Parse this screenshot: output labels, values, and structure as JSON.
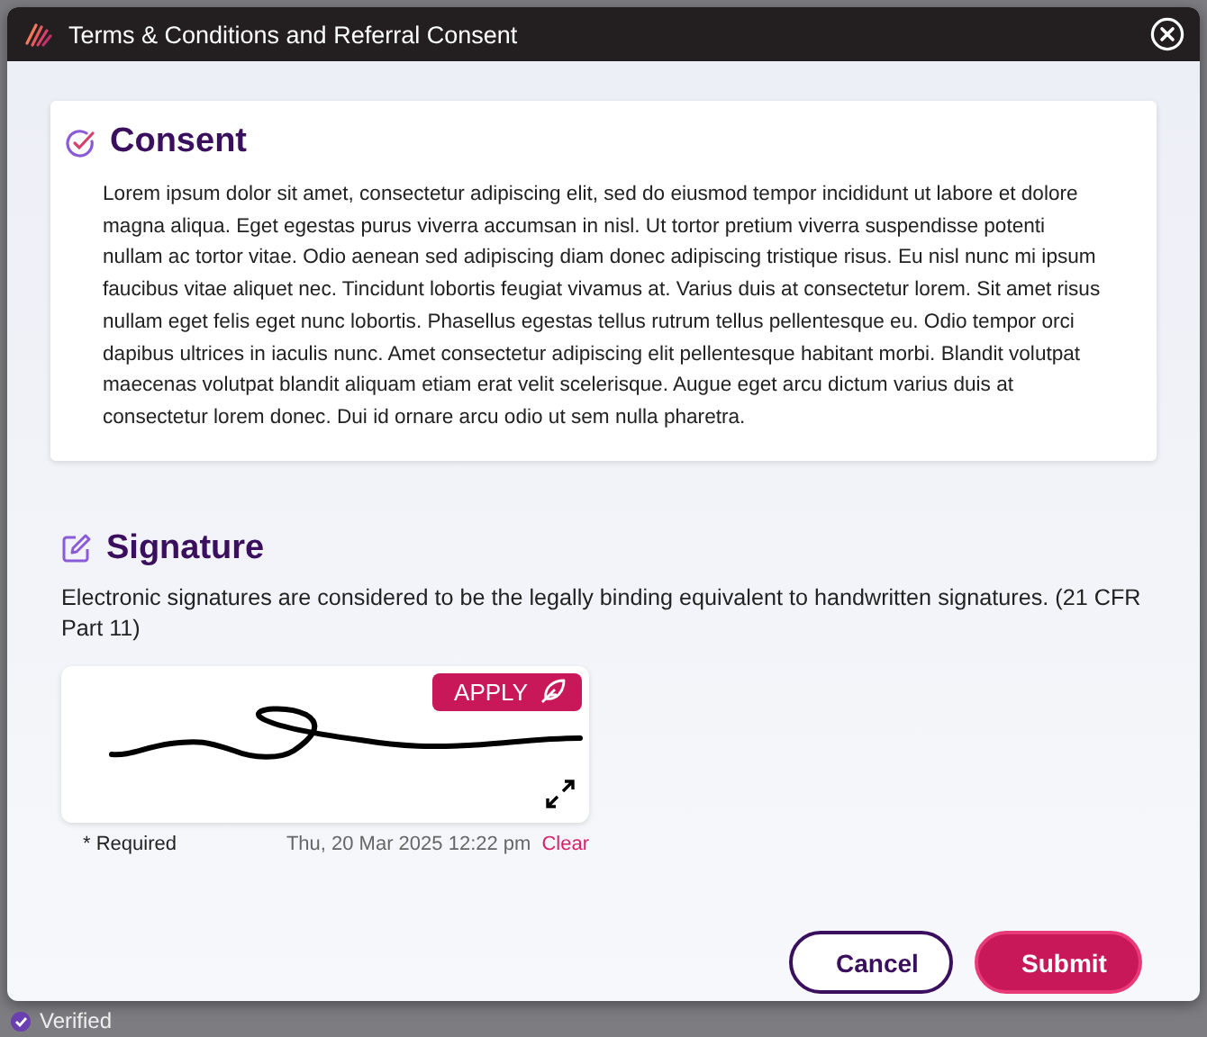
{
  "window": {
    "title": "Terms & Conditions and Referral Consent"
  },
  "consent": {
    "heading": "Consent",
    "text": "Lorem ipsum dolor sit amet, consectetur adipiscing elit, sed do eiusmod tempor incididunt ut labore et dolore magna aliqua. Eget egestas purus viverra accumsan in nisl. Ut tortor pretium viverra suspendisse potenti nullam ac tortor vitae. Odio aenean sed adipiscing diam donec adipiscing tristique risus. Eu nisl nunc mi ipsum faucibus vitae aliquet nec. Tincidunt lobortis feugiat vivamus at. Varius duis at consectetur lorem. Sit amet risus nullam eget felis eget nunc lobortis. Phasellus egestas tellus rutrum tellus pellentesque eu. Odio tempor orci dapibus ultrices in iaculis nunc. Amet consectetur adipiscing elit pellentesque habitant morbi. Blandit volutpat maecenas volutpat blandit aliquam etiam erat velit scelerisque. Augue eget arcu dictum varius duis at consectetur lorem donec. Dui id ornare arcu odio ut sem nulla pharetra."
  },
  "signature": {
    "heading": "Signature",
    "description": "Electronic signatures are considered to be the legally binding equivalent to handwritten signatures. (21 CFR Part 11)",
    "apply_button": "APPLY",
    "required_note": "* Required",
    "timestamp": "Thu, 20 Mar 2025 12:22 pm",
    "clear_link": "Clear"
  },
  "buttons": [
    "Cancel",
    "Submit"
  ],
  "background": {
    "status": "Verified"
  }
}
